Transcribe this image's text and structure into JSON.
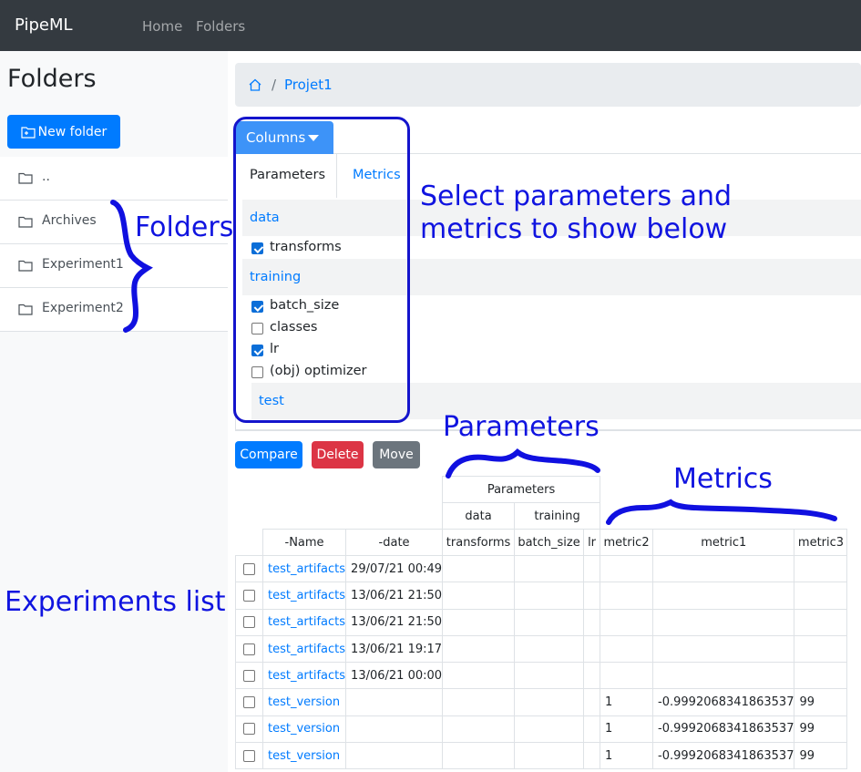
{
  "navbar": {
    "brand": "PipeML",
    "links": [
      "Home",
      "Folders"
    ]
  },
  "sidebar": {
    "title": "Folders",
    "new_folder_label": "New folder",
    "folders": [
      "..",
      "Archives",
      "Experiment1",
      "Experiment2"
    ]
  },
  "breadcrumb": {
    "items": [
      "Projet1"
    ],
    "separator": "/"
  },
  "columns_button": "Columns",
  "tabs": {
    "parameters": "Parameters",
    "metrics": "Metrics"
  },
  "groups": [
    {
      "name": "data",
      "params": [
        {
          "label": "transforms",
          "checked": true
        }
      ]
    },
    {
      "name": "training",
      "params": [
        {
          "label": "batch_size",
          "checked": true
        },
        {
          "label": "classes",
          "checked": false
        },
        {
          "label": "lr",
          "checked": true
        },
        {
          "label": "(obj) optimizer",
          "checked": false
        }
      ]
    },
    {
      "name": "test",
      "params": []
    }
  ],
  "actions": {
    "compare": "Compare",
    "delete": "Delete",
    "move": "Move"
  },
  "table": {
    "group_header": "Parameters",
    "subgroups": [
      "data",
      "training"
    ],
    "columns": [
      "-Name",
      "-date",
      "transforms",
      "batch_size",
      "lr",
      "metric2",
      "metric1",
      "metric3"
    ],
    "rows": [
      [
        "test_artifacts",
        "29/07/21 00:49",
        "",
        "",
        "",
        "",
        "",
        ""
      ],
      [
        "test_artifacts",
        "13/06/21 21:50",
        "",
        "",
        "",
        "",
        "",
        ""
      ],
      [
        "test_artifacts",
        "13/06/21 21:50",
        "",
        "",
        "",
        "",
        "",
        ""
      ],
      [
        "test_artifacts",
        "13/06/21 19:17",
        "",
        "",
        "",
        "",
        "",
        ""
      ],
      [
        "test_artifacts",
        "13/06/21 00:00",
        "",
        "",
        "",
        "",
        "",
        ""
      ],
      [
        "test_version",
        "",
        "",
        "",
        "",
        "1",
        "-0.9992068341863537",
        "99"
      ],
      [
        "test_version",
        "",
        "",
        "",
        "",
        "1",
        "-0.9992068341863537",
        "99"
      ],
      [
        "test_version",
        "",
        "",
        "",
        "",
        "1",
        "-0.9992068341863537",
        "99"
      ]
    ]
  },
  "annotations": {
    "folders": "Folders",
    "select_line1": "Select parameters and",
    "select_line2": "metrics to show below",
    "parameters": "Parameters",
    "metrics": "Metrics",
    "experiments": "Experiments list",
    "color": "#1010e0"
  }
}
